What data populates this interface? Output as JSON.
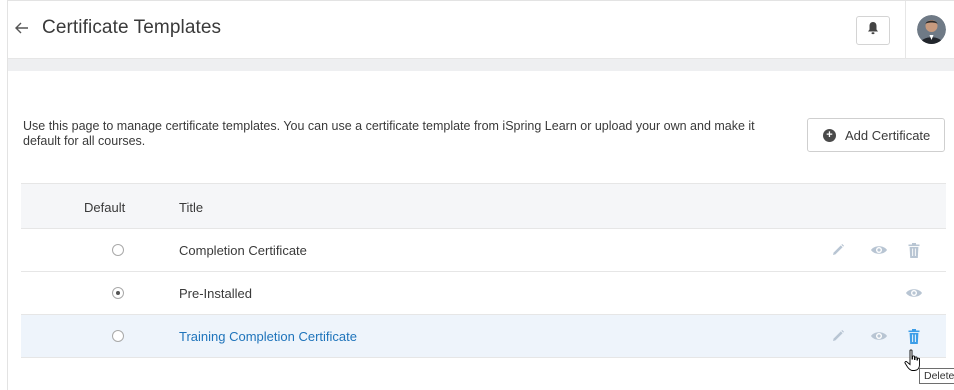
{
  "header": {
    "title": "Certificate Templates",
    "back_icon": "back-arrow-icon",
    "bell_icon": "bell-icon"
  },
  "intro": {
    "text": "Use this page to manage certificate templates. You can use a certificate template from iSpring Learn or upload your own and make it default for all courses."
  },
  "add_button": {
    "label": "Add Certificate",
    "icon": "plus-circle-icon"
  },
  "table": {
    "columns": [
      "Default",
      "Title"
    ],
    "rows": [
      {
        "title": "Completion Certificate",
        "default": false,
        "actions": [
          "edit",
          "view",
          "delete"
        ]
      },
      {
        "title": "Pre-Installed",
        "default": true,
        "actions": [
          "view"
        ]
      },
      {
        "title": "Training Completion Certificate",
        "default": false,
        "actions": [
          "edit",
          "view",
          "delete"
        ]
      }
    ]
  },
  "tooltip": {
    "text": "Delete"
  },
  "colors": {
    "link": "#1f74bb",
    "icon_muted": "#b8c5d3",
    "icon_active": "#3d9ee8",
    "hover_row": "#eef4fb",
    "header_band": "#eeeff1"
  }
}
